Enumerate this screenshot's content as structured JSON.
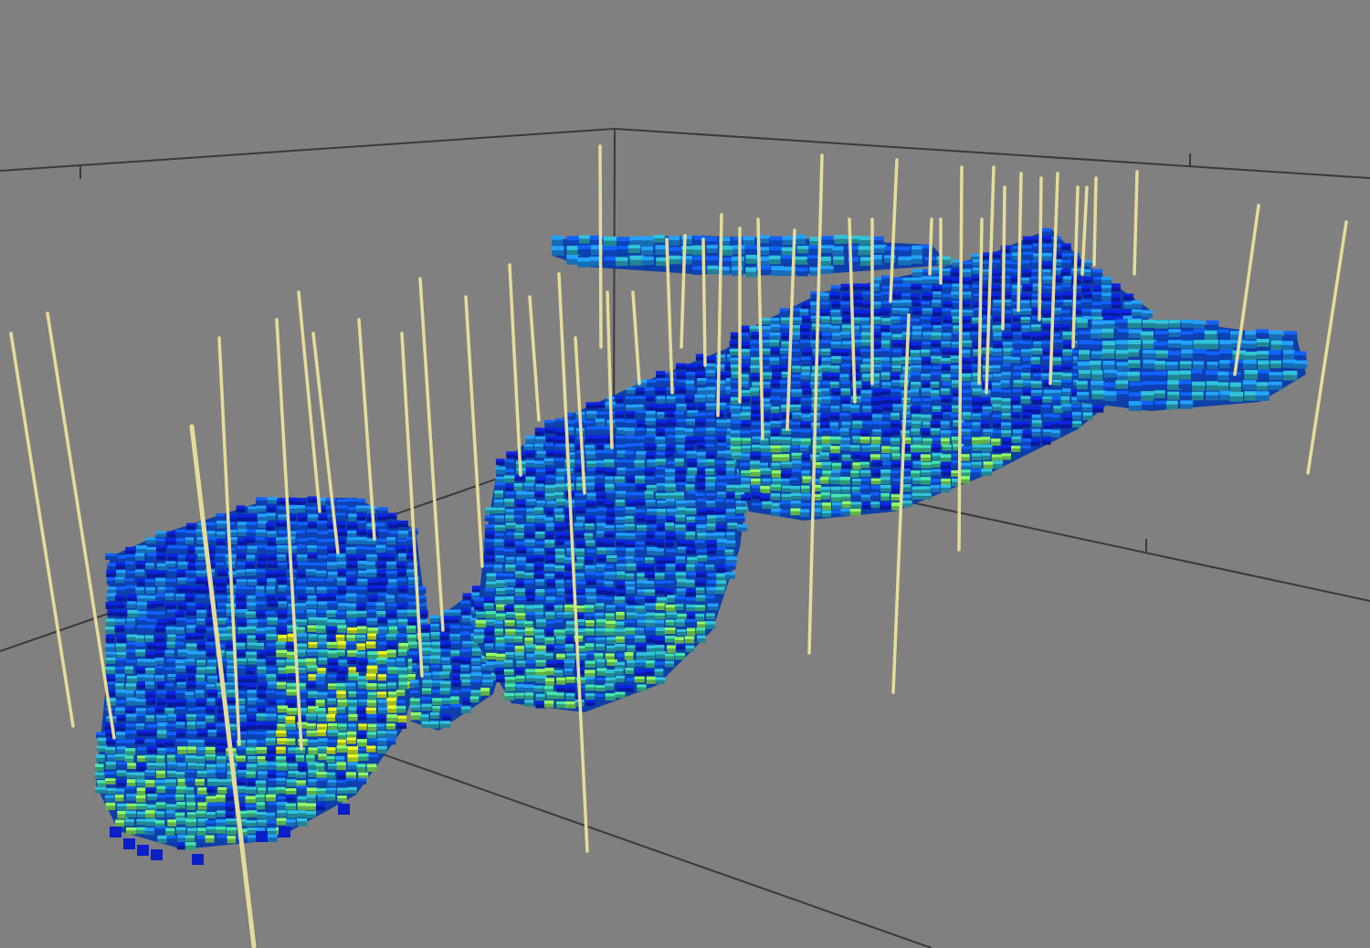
{
  "viewer": {
    "background_color": "#808080",
    "axis_box_color": "#3a3a3a",
    "well_color": "#e6dc9a",
    "property_colormap": [
      "#0a1fc8",
      "#0f55e6",
      "#1e8ce6",
      "#2aaabe",
      "#3cc896",
      "#7ee25a",
      "#d2f01e"
    ],
    "visible_text": []
  }
}
